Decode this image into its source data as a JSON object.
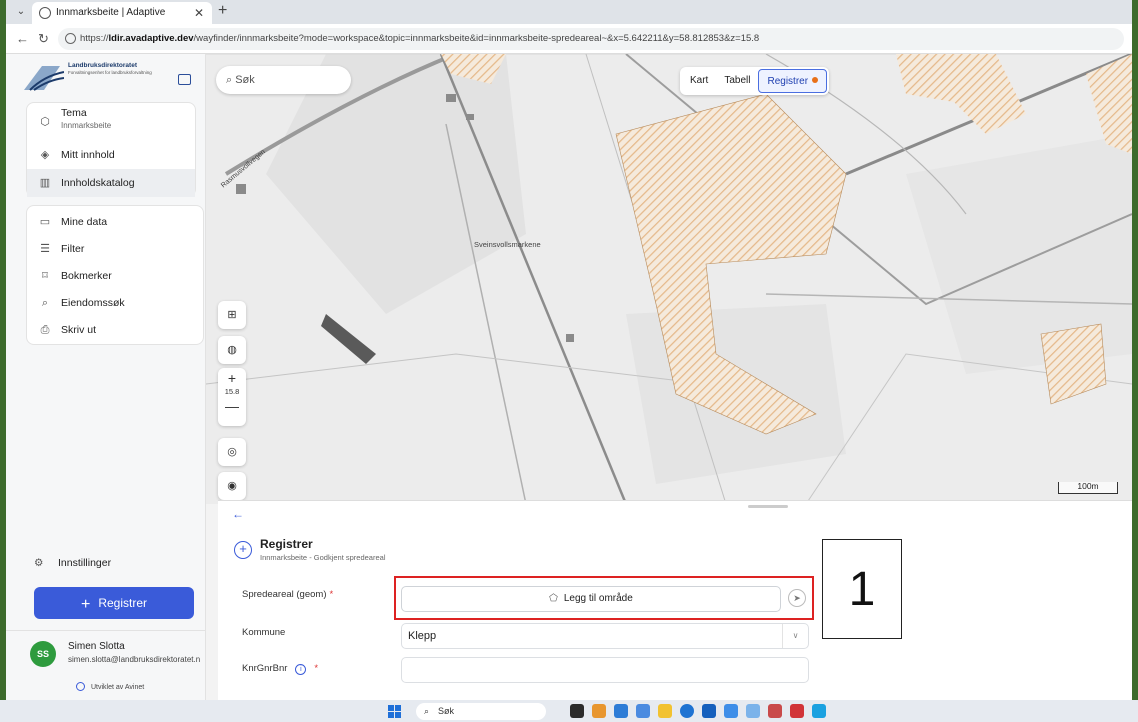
{
  "browser": {
    "tab_title": "Innmarksbeite | Adaptive",
    "url_domain": "ldir.avadaptive.dev",
    "url_path": "/wayfinder/innmarksbeite?mode=workspace&topic=innmarksbeite&id=innmarksbeite-spredeareal~&x=5.642211&y=58.812853&z=15.8"
  },
  "sidebar": {
    "logo_title": "Landbruksdirektoratet",
    "logo_subtitle": "Forvaltningsenhet for landbruksforvaltning",
    "tema_label": "Tema",
    "tema_sub": "Innmarksbeite",
    "group1": [
      "Mitt innhold",
      "Innholdskatalog"
    ],
    "group2": [
      "Mine data",
      "Filter",
      "Bokmerker",
      "Eiendomssøk",
      "Skriv ut"
    ],
    "settings": "Innstillinger",
    "register_button": "Registrer",
    "user_initials": "SS",
    "user_name": "Simen Slotta",
    "user_email": "simen.slotta@landbruksdirektoratet.no",
    "credit": "Utviklet av Avinet"
  },
  "map": {
    "search_placeholder": "Søk",
    "view_tabs": [
      "Kart",
      "Tabell",
      "Registrer"
    ],
    "active_tab": "Registrer",
    "zoom_level": "15.8",
    "zoom_in": "+",
    "zoom_out": "—",
    "scale_label": "100m",
    "place_labels": [
      "Sveinsvollsmarkene",
      "Rasmusvollvegen"
    ],
    "hatch_color": "#e5b98a"
  },
  "panel": {
    "title": "Registrer",
    "subtitle": "Innmarksbeite - Godkjent spredeareal",
    "fields": {
      "spredeareal_label": "Spredeareal (geom)",
      "add_area_button": "Legg til område",
      "kommune_label": "Kommune",
      "kommune_value": "Klepp",
      "knr_label": "KnrGnrBnr"
    },
    "callout_number": "1"
  },
  "taskbar": {
    "search_label": "Søk"
  },
  "colors": {
    "accent": "#3a5bd9",
    "highlight": "#dd2222",
    "avatar": "#2e9b3e"
  }
}
